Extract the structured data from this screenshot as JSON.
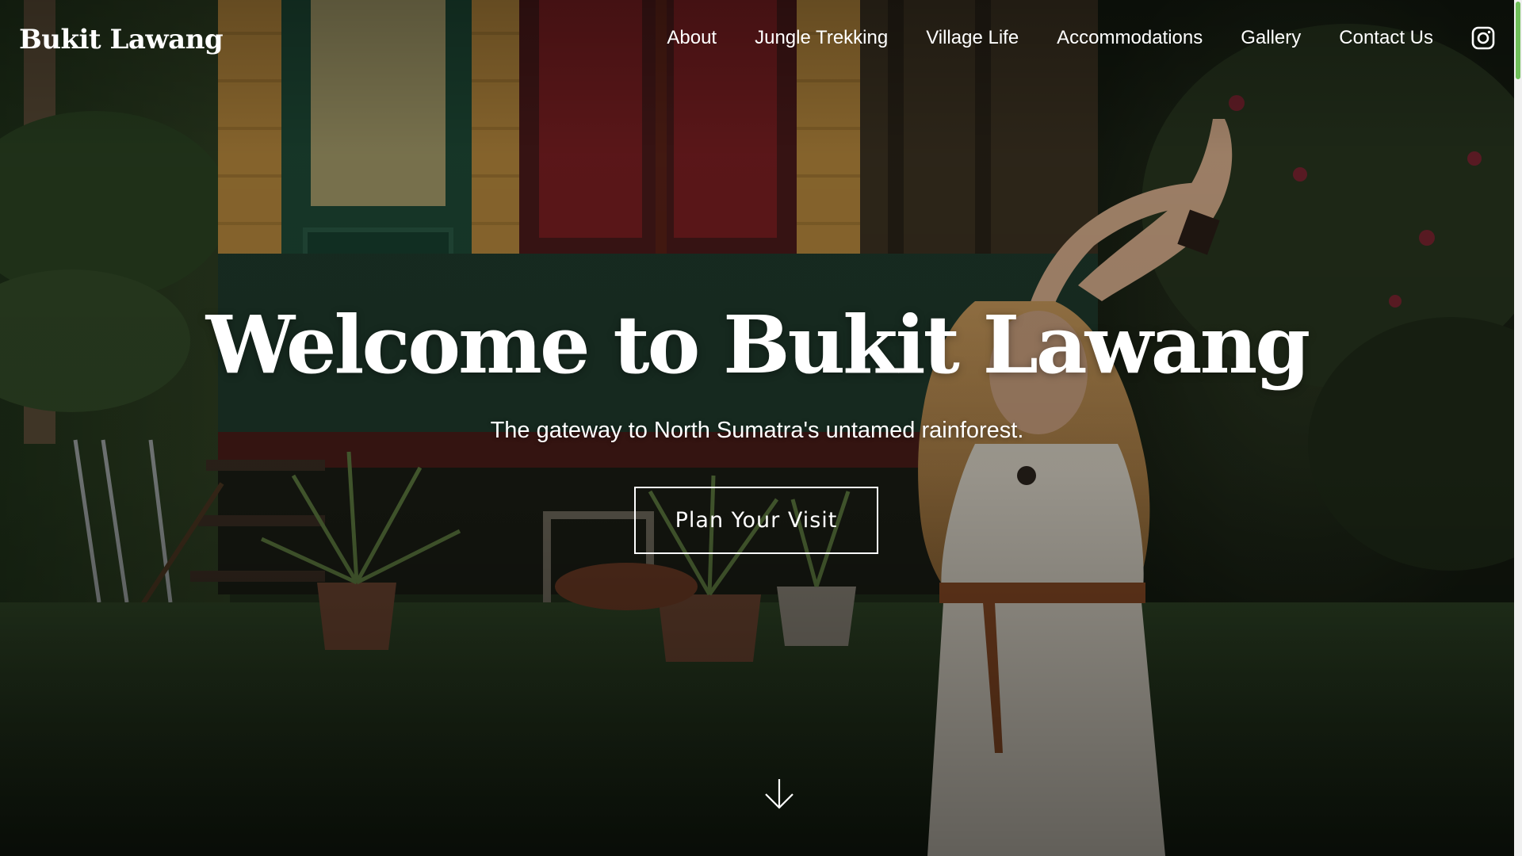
{
  "site": {
    "logo": "Bukit Lawang"
  },
  "nav": {
    "items": [
      {
        "label": "About"
      },
      {
        "label": "Jungle Trekking"
      },
      {
        "label": "Village Life"
      },
      {
        "label": "Accommodations"
      },
      {
        "label": "Gallery"
      },
      {
        "label": "Contact Us"
      }
    ],
    "social_icon": "instagram-icon"
  },
  "hero": {
    "title": "Welcome to Bukit Lawang",
    "subtitle": "The gateway to North Sumatra's untamed rainforest.",
    "cta_label": "Plan Your Visit",
    "scroll_icon": "arrow-down-icon"
  },
  "colors": {
    "text": "#ffffff",
    "scrollbar_thumb": "#6fbf5a",
    "scrollbar_track": "#f1f1f1"
  }
}
